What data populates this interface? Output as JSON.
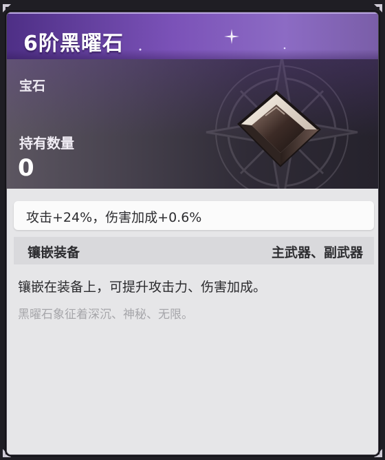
{
  "item": {
    "name": "6阶黑曜石",
    "category": "宝石",
    "owned_label": "持有数量",
    "owned_value": "0",
    "stat": "攻击+24%，伤害加成+0.6%",
    "socket_label": "镶嵌装备",
    "socket_value": "主武器、副武器",
    "description": "镶嵌在装备上，可提升攻击力、伤害加成。",
    "lore": "黑曜石象征着深沉、神秘、无限。"
  },
  "colors": {
    "header_accent": "#7b52b8",
    "panel_bg": "#e6e6e8",
    "lore_text": "#a6a6aa"
  },
  "icons": [
    "obsidian-gem-icon",
    "sparkle-icon",
    "compass-emblem-icon",
    "corner-ornament-icon"
  ]
}
